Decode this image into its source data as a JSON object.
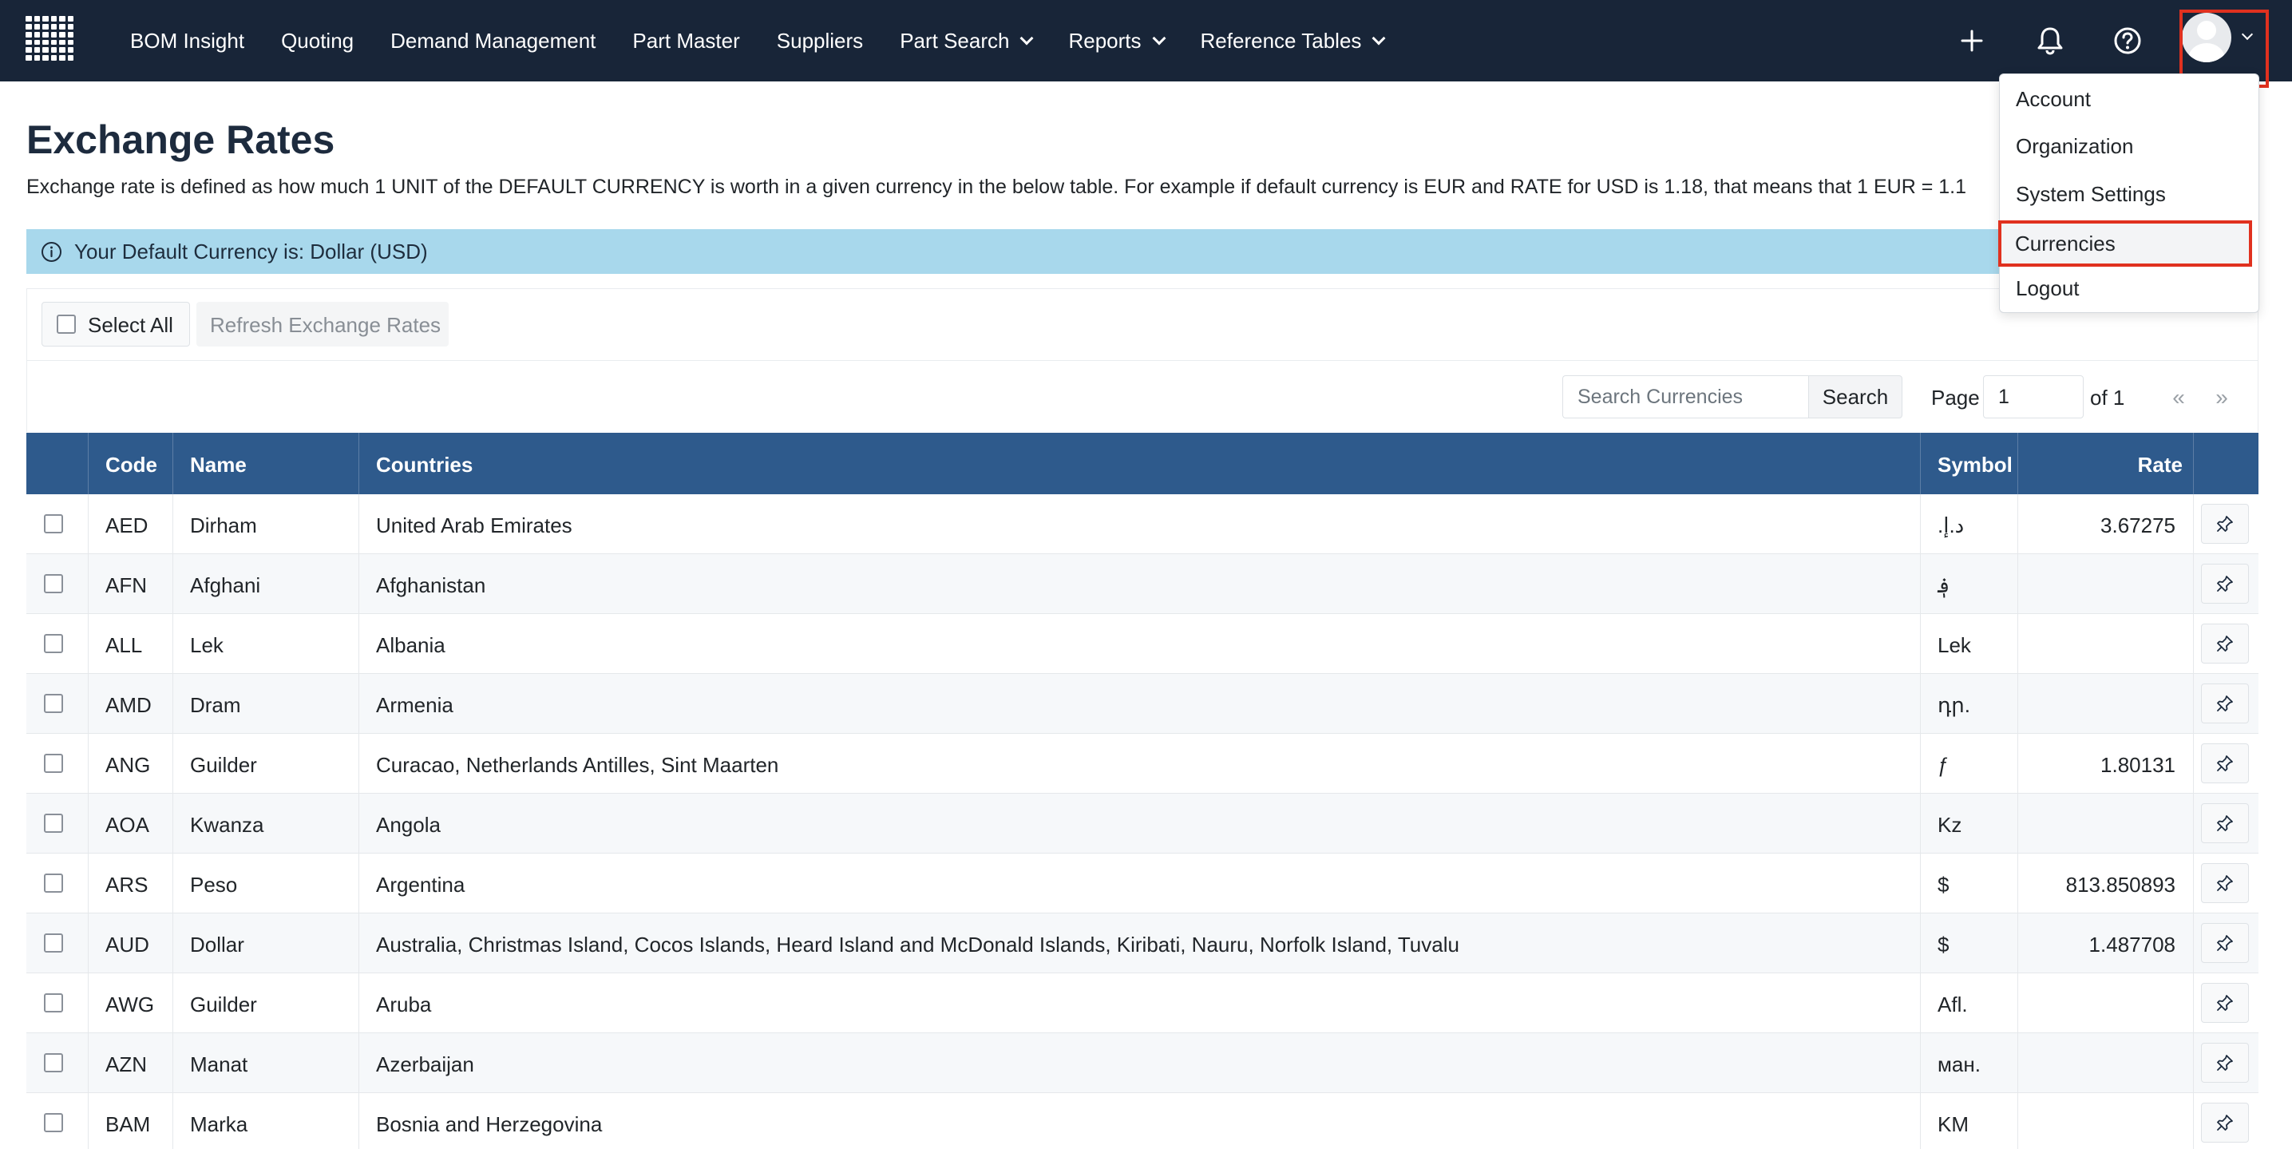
{
  "nav": {
    "items": [
      {
        "label": "BOM Insight",
        "dropdown": false
      },
      {
        "label": "Quoting",
        "dropdown": false
      },
      {
        "label": "Demand Management",
        "dropdown": false
      },
      {
        "label": "Part Master",
        "dropdown": false
      },
      {
        "label": "Suppliers",
        "dropdown": false
      },
      {
        "label": "Part Search",
        "dropdown": true
      },
      {
        "label": "Reports",
        "dropdown": true
      },
      {
        "label": "Reference Tables",
        "dropdown": true
      }
    ],
    "icons": [
      "plus-icon",
      "bell-icon",
      "help-icon",
      "avatar"
    ]
  },
  "user_menu": {
    "items": [
      "Account",
      "Organization",
      "System Settings",
      "Currencies",
      "Logout"
    ],
    "highlighted": "Currencies"
  },
  "page": {
    "title": "Exchange Rates",
    "description": "Exchange rate is defined as how much 1 UNIT of the DEFAULT CURRENCY is worth in a given currency in the below table. For example if default currency is EUR and RATE for USD is 1.18, that means that 1 EUR = 1.1"
  },
  "alert": {
    "text": "Your Default Currency is: Dollar (USD)"
  },
  "toolbar": {
    "select_all": "Select All",
    "refresh": "Refresh Exchange Rates",
    "search_placeholder": "Search Currencies",
    "search_button": "Search",
    "page_label": "Page",
    "page_value": "1",
    "page_of": "of 1",
    "prev": "«",
    "next": "»"
  },
  "table": {
    "columns": [
      "Code",
      "Name",
      "Countries",
      "Symbol",
      "Rate"
    ],
    "rows": [
      {
        "code": "AED",
        "name": "Dirham",
        "countries": "United Arab Emirates",
        "symbol": ".د.إ",
        "rate": "3.67275"
      },
      {
        "code": "AFN",
        "name": "Afghani",
        "countries": "Afghanistan",
        "symbol": "؋",
        "rate": ""
      },
      {
        "code": "ALL",
        "name": "Lek",
        "countries": "Albania",
        "symbol": "Lek",
        "rate": ""
      },
      {
        "code": "AMD",
        "name": "Dram",
        "countries": "Armenia",
        "symbol": "դր.",
        "rate": ""
      },
      {
        "code": "ANG",
        "name": "Guilder",
        "countries": "Curacao, Netherlands Antilles, Sint Maarten",
        "symbol": "ƒ",
        "rate": "1.80131"
      },
      {
        "code": "AOA",
        "name": "Kwanza",
        "countries": "Angola",
        "symbol": "Kz",
        "rate": ""
      },
      {
        "code": "ARS",
        "name": "Peso",
        "countries": "Argentina",
        "symbol": "$",
        "rate": "813.850893"
      },
      {
        "code": "AUD",
        "name": "Dollar",
        "countries": "Australia, Christmas Island, Cocos Islands, Heard Island and McDonald Islands, Kiribati, Nauru, Norfolk Island, Tuvalu",
        "symbol": "$",
        "rate": "1.487708"
      },
      {
        "code": "AWG",
        "name": "Guilder",
        "countries": "Aruba",
        "symbol": "Afl.",
        "rate": ""
      },
      {
        "code": "AZN",
        "name": "Manat",
        "countries": "Azerbaijan",
        "symbol": "ман.",
        "rate": ""
      },
      {
        "code": "BAM",
        "name": "Marka",
        "countries": "Bosnia and Herzegovina",
        "symbol": "KM",
        "rate": ""
      }
    ]
  },
  "colors": {
    "navbar": "#182538",
    "table_header": "#2e5a8c",
    "alert_bg": "#a8d8ec",
    "highlight_red": "#e0311f"
  }
}
